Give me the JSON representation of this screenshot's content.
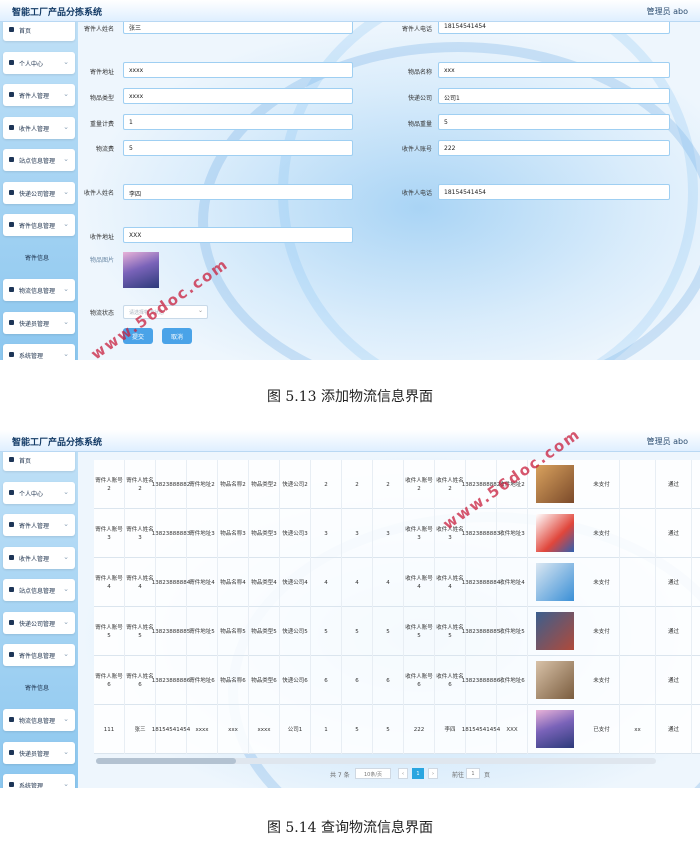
{
  "app_title": "智能工厂产品分拣系统",
  "admin_label": "管理员 abo",
  "sidebar_top": [
    {
      "label": "首页",
      "has_chevron": false
    },
    {
      "label": "个人中心",
      "has_chevron": true
    },
    {
      "label": "寄件人管理",
      "has_chevron": true
    },
    {
      "label": "收件人管理",
      "has_chevron": true
    },
    {
      "label": "站点信息管理",
      "has_chevron": true
    },
    {
      "label": "快递公司管理",
      "has_chevron": true
    },
    {
      "label": "寄件信息管理",
      "has_chevron": true
    },
    {
      "label": "寄件信息",
      "sub": true
    },
    {
      "label": "物流信息管理",
      "has_chevron": true
    },
    {
      "label": "快递员管理",
      "has_chevron": true
    },
    {
      "label": "系统管理",
      "has_chevron": true
    }
  ],
  "form": {
    "sender_name_label": "寄件人姓名",
    "sender_name_value": "张三",
    "sender_phone_label": "寄件人电话",
    "sender_phone_value": "18154541454",
    "sender_addr_label": "寄件地址",
    "sender_addr_value": "xxxx",
    "item_name_label": "物品名称",
    "item_name_value": "xxx",
    "item_type_label": "物品类型",
    "item_type_value": "xxxx",
    "courier_label": "快递公司",
    "courier_value": "公司1",
    "weight_calc_label": "重量计费",
    "weight_calc_value": "1",
    "item_weight_label": "物品重量",
    "item_weight_value": "5",
    "fee_label": "物流费",
    "fee_value": "5",
    "receiver_account_label": "收件人账号",
    "receiver_account_value": "222",
    "receiver_name_label": "收件人姓名",
    "receiver_name_value": "李四",
    "receiver_phone_label": "收件人电话",
    "receiver_phone_value": "18154541454",
    "receiver_addr_label": "收件地址",
    "receiver_addr_value": "XXX",
    "image_label": "物品图片",
    "status_label": "物流状态",
    "status_placeholder": "请选择物流状态",
    "submit_label": "提交",
    "cancel_label": "取消"
  },
  "caption1": "图 5.13 添加物流信息界面",
  "caption2": "图 5.14 查询物流信息界面",
  "table_rows": [
    {
      "cells": [
        "寄件人账号2",
        "寄件人姓名2",
        "13823888882",
        "寄件地址2",
        "物品名称2",
        "物品类型2",
        "快递公司2",
        "2",
        "2",
        "2",
        "收件人账号2",
        "收件人姓名2",
        "13823888882",
        "收件地址2"
      ],
      "pay": "未支付",
      "extra": "",
      "audit": "通过",
      "img": "photo-warm"
    },
    {
      "cells": [
        "寄件人账号3",
        "寄件人姓名3",
        "13823888883",
        "寄件地址3",
        "物品名称3",
        "物品类型3",
        "快递公司3",
        "3",
        "3",
        "3",
        "收件人账号3",
        "收件人姓名3",
        "13823888883",
        "收件地址3"
      ],
      "pay": "未支付",
      "extra": "",
      "audit": "通过",
      "img": "delivery-cartoon"
    },
    {
      "cells": [
        "寄件人账号4",
        "寄件人姓名4",
        "13823888884",
        "寄件地址4",
        "物品名称4",
        "物品类型4",
        "快递公司4",
        "4",
        "4",
        "4",
        "收件人账号4",
        "收件人姓名4",
        "13823888884",
        "收件地址4"
      ],
      "pay": "未支付",
      "extra": "",
      "audit": "通过",
      "img": "courier-icon"
    },
    {
      "cells": [
        "寄件人账号5",
        "寄件人姓名5",
        "13823888885",
        "寄件地址5",
        "物品名称5",
        "物品类型5",
        "快递公司5",
        "5",
        "5",
        "5",
        "收件人账号5",
        "收件人姓名5",
        "13823888885",
        "收件地址5"
      ],
      "pay": "未支付",
      "extra": "",
      "audit": "通过",
      "img": "photo-boxes"
    },
    {
      "cells": [
        "寄件人账号6",
        "寄件人姓名6",
        "13823888886",
        "寄件地址6",
        "物品名称6",
        "物品类型6",
        "快递公司6",
        "6",
        "6",
        "6",
        "收件人账号6",
        "收件人姓名6",
        "13823888886",
        "收件地址6"
      ],
      "pay": "未支付",
      "extra": "",
      "audit": "通过",
      "img": "photo-parcel"
    },
    {
      "cells": [
        "111",
        "张三",
        "18154541454",
        "xxxx",
        "xxx",
        "xxxx",
        "公司1",
        "1",
        "5",
        "5",
        "222",
        "李四",
        "18154541454",
        "XXX"
      ],
      "pay": "已支付",
      "extra": "xx",
      "audit": "通过",
      "img": "photo-city"
    }
  ],
  "pager": {
    "total": "共 7 条",
    "page_size": "10条/页",
    "current_page": "1",
    "goto_label": "前往",
    "goto_value": "1",
    "page_unit": "页"
  },
  "watermark": "www.56doc.com"
}
